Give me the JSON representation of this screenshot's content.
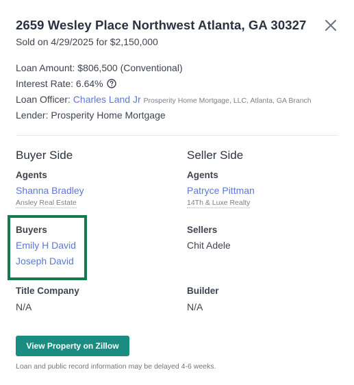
{
  "header": {
    "address": "2659 Wesley Place Northwest Atlanta, GA 30327",
    "sold_text": "Sold on 4/29/2025 for $2,150,000"
  },
  "loan": {
    "amount": "Loan Amount: $806,500 (Conventional)",
    "rate": "Interest Rate: 6.64%",
    "officer_label": "Loan Officer:",
    "officer_name": "Charles Land Jr",
    "officer_org": "Prosperity Home Mortgage, LLC, Atlanta, GA Branch",
    "lender": "Lender: Prosperity Home Mortgage"
  },
  "buyer_side": {
    "title": "Buyer Side",
    "agents_label": "Agents",
    "agent_name": "Shanna Bradley",
    "agent_brokerage": "Ansley Real Estate",
    "parties_label": "Buyers",
    "parties": [
      "Emily H David",
      "Joseph David"
    ],
    "title_company_label": "Title Company",
    "title_company_value": "N/A"
  },
  "seller_side": {
    "title": "Seller Side",
    "agents_label": "Agents",
    "agent_name": "Patryce Pittman",
    "agent_brokerage": "14Th & Luxe Realty",
    "parties_label": "Sellers",
    "parties": [
      "Chit Adele"
    ],
    "builder_label": "Builder",
    "builder_value": "N/A"
  },
  "actions": {
    "view_button": "View Property on Zillow"
  },
  "footnote": "Loan and public record information may be delayed 4-6 weeks.",
  "icons": {
    "close": "close-icon",
    "help": "help-circle-icon"
  },
  "colors": {
    "link": "#5a78d6",
    "button": "#1b8c82",
    "highlight": "#137a4d"
  }
}
